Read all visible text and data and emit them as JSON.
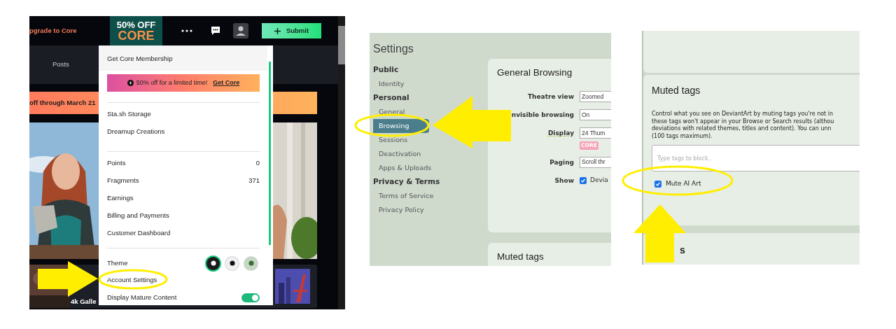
{
  "deviantart_menu": {
    "top_bar": {
      "upgrade_link": "pgrade to Core",
      "promo_badge": {
        "line_1": "50% OFF",
        "line_2": "CORE"
      },
      "submit_button": "Submit"
    },
    "nav_tab": "Posts",
    "banner": "off through March 21",
    "card_title": "4k Galle",
    "dropdown": {
      "header": "Get Core Membership",
      "promo": {
        "text": "50% off for a limited time!",
        "link": "Get Core"
      },
      "groups": [
        [
          {
            "label": "Sta.sh Storage"
          },
          {
            "label": "Dreamup Creations"
          }
        ],
        [
          {
            "label": "Points",
            "value": "0"
          },
          {
            "label": "Fragments",
            "value": "371"
          },
          {
            "label": "Earnings"
          },
          {
            "label": "Billing and Payments"
          },
          {
            "label": "Customer Dashboard"
          }
        ]
      ],
      "theme": {
        "label": "Theme",
        "options": [
          {
            "kind": "dark",
            "selected": true
          },
          {
            "kind": "light",
            "selected": false
          },
          {
            "kind": "green",
            "selected": false
          }
        ]
      },
      "account_settings": "Account Settings",
      "mature": {
        "label": "Display Mature Content",
        "on": true
      }
    }
  },
  "settings_page": {
    "title": "Settings",
    "nav": [
      {
        "heading": "Public",
        "items": [
          {
            "label": "Identity",
            "selected": false
          }
        ]
      },
      {
        "heading": "Personal",
        "items": [
          {
            "label": "General",
            "selected": false
          },
          {
            "label": "Browsing",
            "selected": true
          },
          {
            "label": "Sessions",
            "selected": false
          },
          {
            "label": "Deactivation",
            "selected": false
          },
          {
            "label": "Apps & Uploads",
            "selected": false
          }
        ]
      },
      {
        "heading": "Privacy & Terms",
        "items": [
          {
            "label": "Terms of Service",
            "selected": false
          },
          {
            "label": "Privacy Policy",
            "selected": false
          }
        ]
      }
    ],
    "general_browsing": {
      "title": "General Browsing",
      "rows": [
        {
          "label": "Theatre view",
          "kind": "select",
          "value": "Zoomed"
        },
        {
          "label": "nvisible browsing",
          "kind": "select",
          "value": "On"
        },
        {
          "label": "Display",
          "kind": "select",
          "value": "24 Thum",
          "hint": true,
          "badge": "CORE"
        },
        {
          "label": "Paging",
          "kind": "select",
          "value": "Scroll thr"
        },
        {
          "label": "Show",
          "kind": "checkbox",
          "value": "Devia",
          "checked": true
        }
      ]
    },
    "next_card_title": "Muted tags"
  },
  "muted_tags_page": {
    "title": "Muted tags",
    "description_lines": [
      "Control what you see on DeviantArt by muting tags you're not in",
      "these tags won't appear in your Browse or Search results (althou",
      "deviations with related themes, titles and content). You can unn",
      "(100 tags maximum)."
    ],
    "input": {
      "placeholder": "Type tags to block.."
    },
    "mute_ai": {
      "label": "Mute AI Art",
      "checked": true
    },
    "next_heading": "s"
  }
}
